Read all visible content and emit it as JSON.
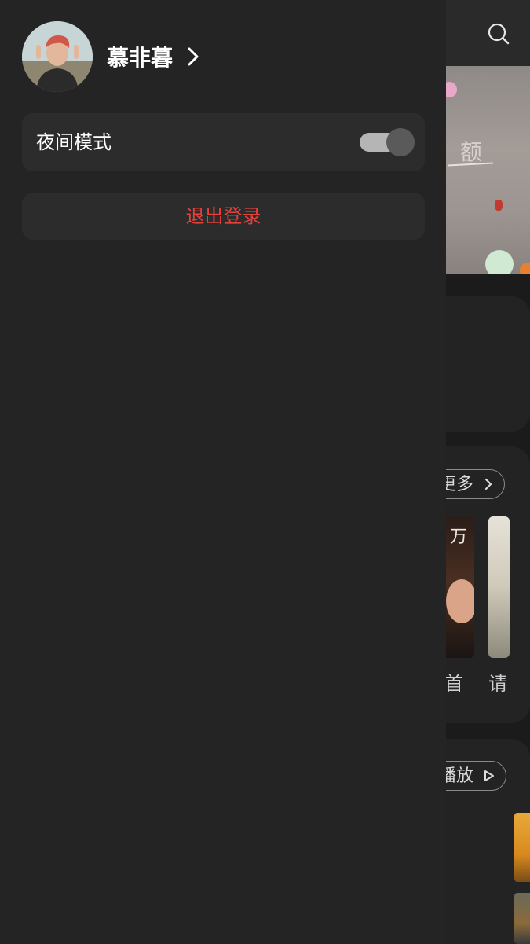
{
  "drawer": {
    "username": "慕非暮",
    "night_mode": {
      "label": "夜间模式",
      "enabled": true
    },
    "logout_label": "退出登录",
    "colors": {
      "drawer_bg": "#242424",
      "card_bg": "#2c2c2c",
      "logout_text": "#e5413a"
    }
  },
  "background": {
    "banner_text": "额",
    "more_label": "更多",
    "play_label": "播放",
    "thumb_overlay_text": "万",
    "captions": [
      "首",
      "请"
    ]
  }
}
